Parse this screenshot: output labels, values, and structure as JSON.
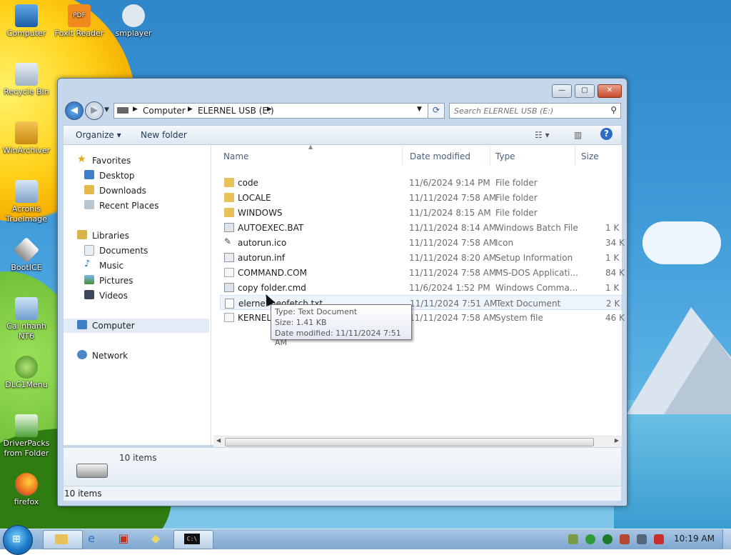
{
  "desktop_icons": [
    {
      "label": "Computer"
    },
    {
      "label": "Foxit Reader"
    },
    {
      "label": "smplayer"
    },
    {
      "label": "Recycle Bin"
    },
    {
      "label": "WinArchiver"
    },
    {
      "label": "Acronis TrueImage"
    },
    {
      "label": "BootICE"
    },
    {
      "label": "Cai nhanh NT6"
    },
    {
      "label": "DLC1Menu"
    },
    {
      "label": "DriverPacks from Folder"
    },
    {
      "label": "firefox"
    }
  ],
  "window": {
    "controls": {
      "minimize": "—",
      "maximize": "▢",
      "close": "✕"
    },
    "address": {
      "root": "Computer",
      "location": "ELERNEL USB (E:)"
    },
    "search_placeholder": "Search ELERNEL USB (E:)",
    "toolbar": {
      "organize": "Organize",
      "new_folder": "New folder"
    },
    "nav_pane": {
      "favorites": "Favorites",
      "favorites_items": [
        "Desktop",
        "Downloads",
        "Recent Places"
      ],
      "libraries": "Libraries",
      "libraries_items": [
        "Documents",
        "Music",
        "Pictures",
        "Videos"
      ],
      "computer": "Computer",
      "network": "Network"
    },
    "columns": {
      "name": "Name",
      "date": "Date modified",
      "type": "Type",
      "size": "Size"
    },
    "files": [
      {
        "name": "code",
        "date": "11/6/2024 9:14 PM",
        "type": "File folder",
        "size": "",
        "icon": "folder-icon"
      },
      {
        "name": "LOCALE",
        "date": "11/11/2024 7:58 AM",
        "type": "File folder",
        "size": "",
        "icon": "folder-icon"
      },
      {
        "name": "WINDOWS",
        "date": "11/1/2024 8:15 AM",
        "type": "File folder",
        "size": "",
        "icon": "folder-icon"
      },
      {
        "name": "AUTOEXEC.BAT",
        "date": "11/11/2024 8:14 AM",
        "type": "Windows Batch File",
        "size": "1 K",
        "icon": "batch-file-icon"
      },
      {
        "name": "autorun.ico",
        "date": "11/11/2024 7:58 AM",
        "type": "Icon",
        "size": "34 K",
        "icon": "ico-file-icon"
      },
      {
        "name": "autorun.inf",
        "date": "11/11/2024 8:20 AM",
        "type": "Setup Information",
        "size": "1 K",
        "icon": "inf-file-icon"
      },
      {
        "name": "COMMAND.COM",
        "date": "11/11/2024 7:58 AM",
        "type": "MS-DOS Applicati...",
        "size": "84 K",
        "icon": "com-file-icon"
      },
      {
        "name": "copy folder.cmd",
        "date": "11/6/2024 1:52 PM",
        "type": "Windows Comma...",
        "size": "1 K",
        "icon": "cmd-file-icon"
      },
      {
        "name": "elernel neofetch.txt",
        "date": "11/11/2024 7:51 AM",
        "type": "Text Document",
        "size": "2 K",
        "icon": "text-file-icon"
      },
      {
        "name": "KERNEL.",
        "date": "11/11/2024 7:58 AM",
        "type": "System file",
        "size": "46 K",
        "icon": "system-file-icon"
      }
    ],
    "details_count": "10 items",
    "status_text": "10 items"
  },
  "tooltip": {
    "type": "Type: Text Document",
    "size": "Size: 1.41 KB",
    "date": "Date modified: 11/11/2024 7:51 AM"
  },
  "taskbar": {
    "clock": "10:19 AM"
  },
  "colors": {
    "window_frame": "#c5d7ea",
    "selection": "#eef4fb",
    "folder": "#e8c15a",
    "taskbar": "#8fb3d8"
  }
}
